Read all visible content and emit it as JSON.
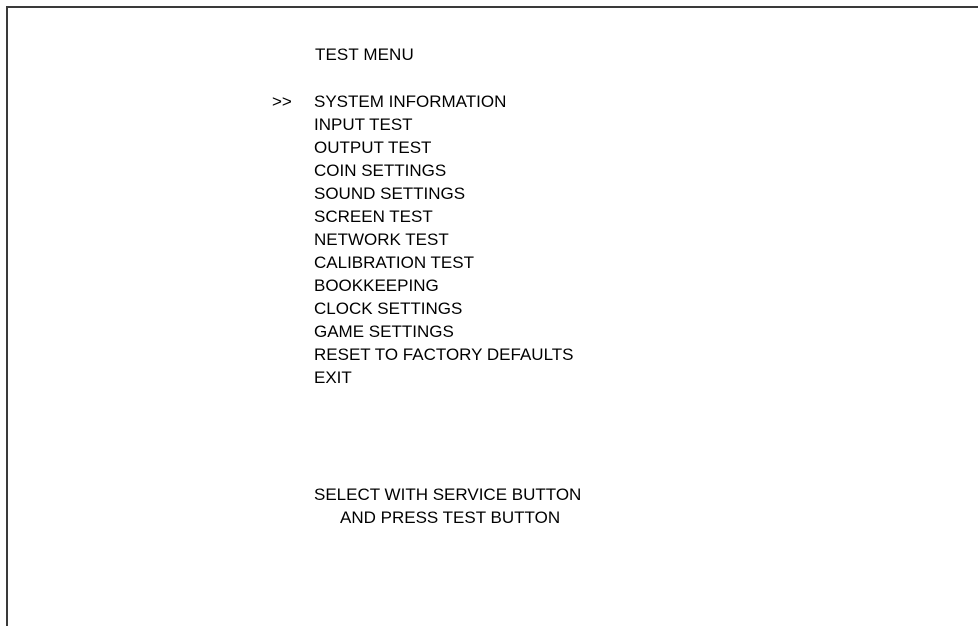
{
  "title": "TEST MENU",
  "cursor": ">>",
  "selected_index": 0,
  "menu": [
    {
      "label": "SYSTEM INFORMATION"
    },
    {
      "label": "INPUT TEST"
    },
    {
      "label": "OUTPUT TEST"
    },
    {
      "label": "COIN SETTINGS"
    },
    {
      "label": "SOUND SETTINGS"
    },
    {
      "label": "SCREEN TEST"
    },
    {
      "label": "NETWORK TEST"
    },
    {
      "label": "CALIBRATION TEST"
    },
    {
      "label": "BOOKKEEPING"
    },
    {
      "label": "CLOCK SETTINGS"
    },
    {
      "label": "GAME SETTINGS"
    },
    {
      "label": "RESET TO FACTORY DEFAULTS"
    },
    {
      "label": "EXIT"
    }
  ],
  "instructions": {
    "line1": "SELECT WITH SERVICE BUTTON",
    "line2": "AND PRESS TEST BUTTON"
  }
}
